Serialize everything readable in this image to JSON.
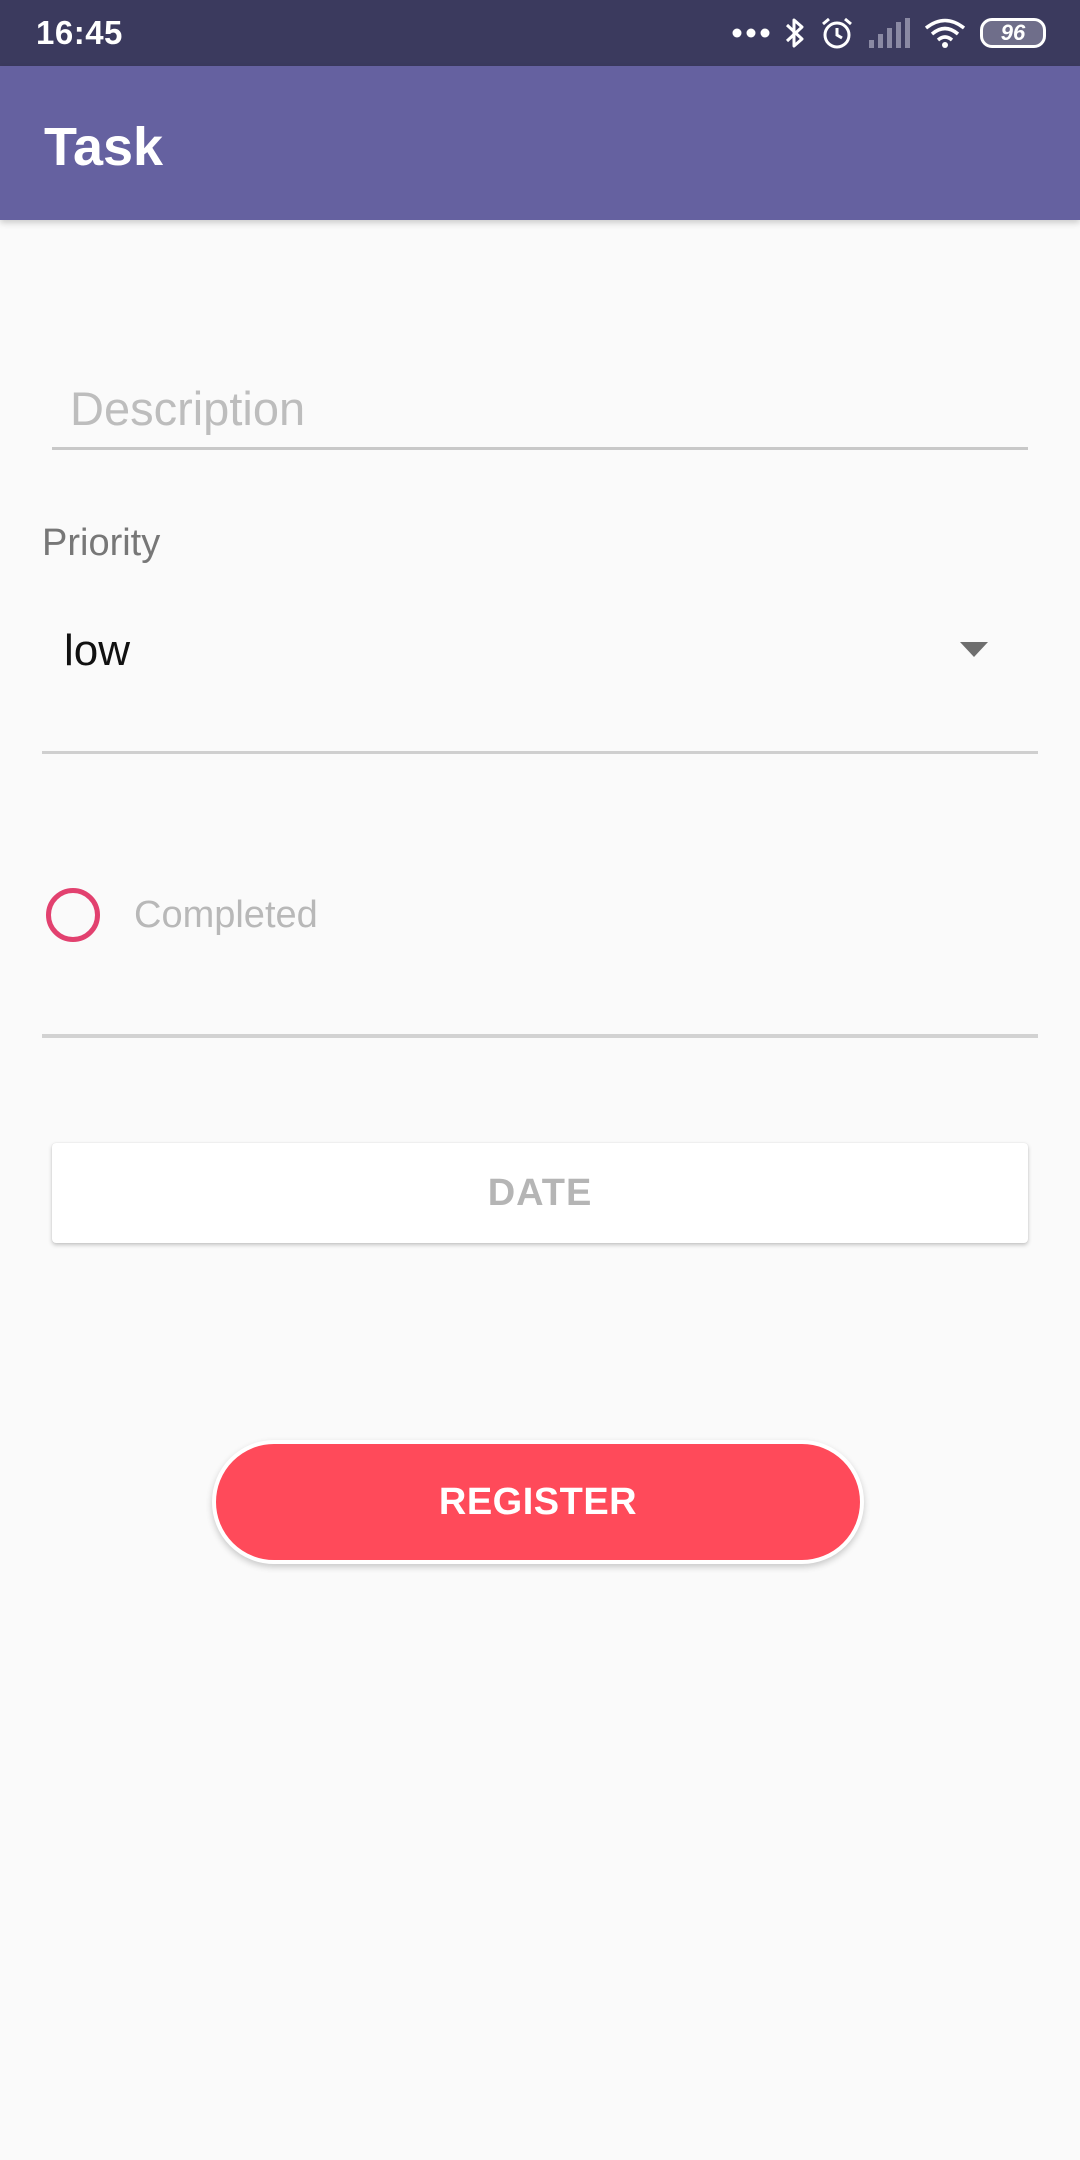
{
  "status_bar": {
    "time": "16:45",
    "battery_level": "96",
    "icons": [
      "more-dots-icon",
      "bluetooth-icon",
      "alarm-icon",
      "signal-icon",
      "wifi-icon",
      "battery-icon"
    ]
  },
  "app_bar": {
    "title": "Task",
    "background_color": "#6561a0"
  },
  "form": {
    "description": {
      "placeholder": "Description",
      "value": ""
    },
    "priority": {
      "label": "Priority",
      "selected": "low"
    },
    "completed": {
      "label": "Completed",
      "checked": false,
      "accent_color": "#e2416f"
    },
    "date_button": {
      "label": "DATE"
    },
    "register_button": {
      "label": "REGISTER",
      "color": "#ff4a5a"
    }
  }
}
